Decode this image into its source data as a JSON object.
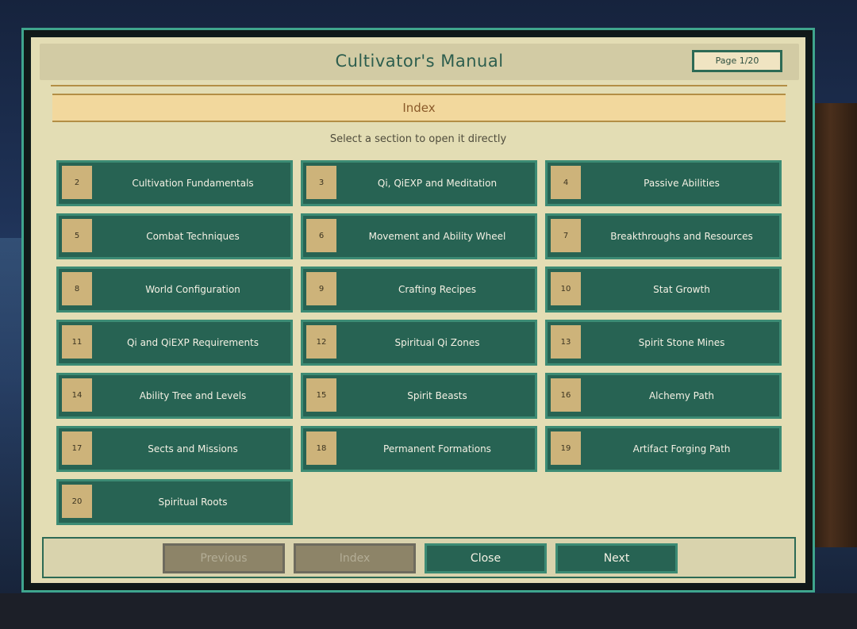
{
  "window": {
    "title": "Cultivator's Manual",
    "page_indicator": "Page 1/20"
  },
  "index": {
    "heading": "Index",
    "subtitle": "Select a section to open it directly"
  },
  "sections": [
    {
      "number": "2",
      "label": "Cultivation Fundamentals"
    },
    {
      "number": "3",
      "label": "Qi, QiEXP and Meditation"
    },
    {
      "number": "4",
      "label": "Passive Abilities"
    },
    {
      "number": "5",
      "label": "Combat Techniques"
    },
    {
      "number": "6",
      "label": "Movement and Ability Wheel"
    },
    {
      "number": "7",
      "label": "Breakthroughs and Resources"
    },
    {
      "number": "8",
      "label": "World Configuration"
    },
    {
      "number": "9",
      "label": "Crafting Recipes"
    },
    {
      "number": "10",
      "label": "Stat Growth"
    },
    {
      "number": "11",
      "label": "Qi and QiEXP Requirements"
    },
    {
      "number": "12",
      "label": "Spiritual Qi Zones"
    },
    {
      "number": "13",
      "label": "Spirit Stone Mines"
    },
    {
      "number": "14",
      "label": "Ability Tree and Levels"
    },
    {
      "number": "15",
      "label": "Spirit Beasts"
    },
    {
      "number": "16",
      "label": "Alchemy Path"
    },
    {
      "number": "17",
      "label": "Sects and Missions"
    },
    {
      "number": "18",
      "label": "Permanent Formations"
    },
    {
      "number": "19",
      "label": "Artifact Forging Path"
    },
    {
      "number": "20",
      "label": "Spiritual Roots"
    }
  ],
  "footer": {
    "previous_label": "Previous",
    "index_label": "Index",
    "close_label": "Close",
    "next_label": "Next"
  },
  "colors": {
    "panel_border": "#3fa58d",
    "panel_bg": "#e3ddb4",
    "button_bg": "#276353",
    "number_box": "#cdb37a",
    "index_bar": "#f2d89d",
    "disabled_button": "#8d8468"
  }
}
